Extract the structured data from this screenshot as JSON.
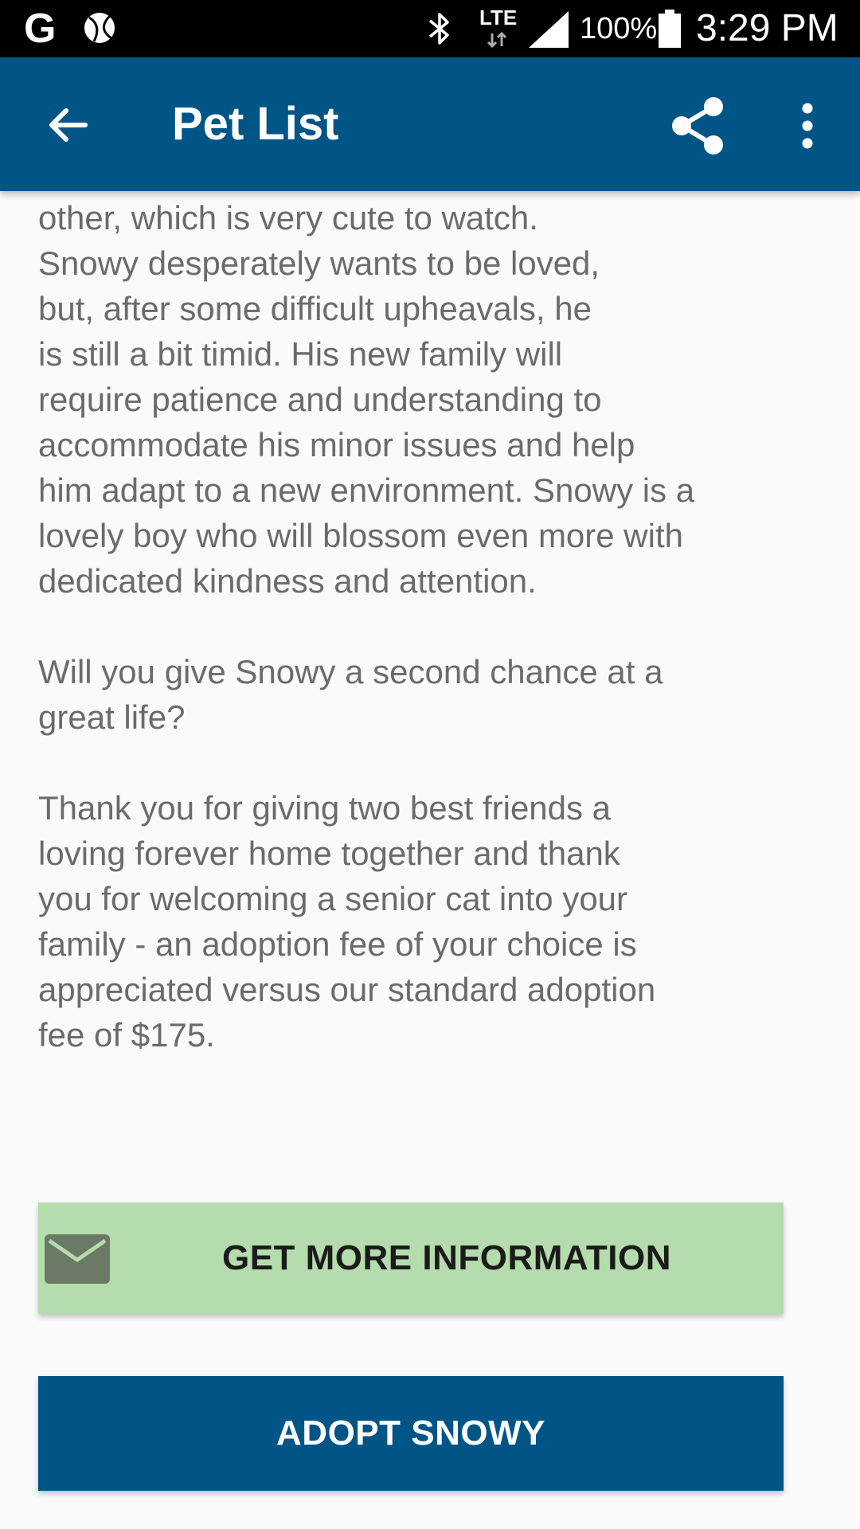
{
  "status_bar": {
    "lte_label": "LTE",
    "battery_percent": "100%",
    "time": "3:29 PM",
    "icons": [
      "google-icon",
      "ball-icon",
      "bluetooth-icon",
      "lte-icon",
      "signal-icon",
      "battery-icon"
    ]
  },
  "app_bar": {
    "title": "Pet List",
    "back_icon": "arrow-left-icon",
    "share_icon": "share-icon",
    "more_icon": "more-vert-icon",
    "color": "#005587"
  },
  "description": {
    "paragraphs": [
      "their own thing, but they do love to groom\nother, which is very cute to watch.\nSnowy desperately wants to be loved,\nbut, after some difficult upheavals, he\nis still a bit timid. His new family will\nrequire patience and understanding to\naccommodate his minor issues and help\nhim adapt to a new environment. Snowy is a\nlovely boy who will blossom even more with\ndedicated kindness and attention.",
      "Will you give Snowy a second chance at a\ngreat life?",
      "Thank you for giving two best friends a\nloving forever home together and thank\nyou for welcoming a senior cat into your\nfamily - an adoption fee of your choice is\nappreciated versus our standard adoption\nfee of $175."
    ]
  },
  "info_button": {
    "label": "GET MORE INFORMATION",
    "icon": "mail-icon",
    "color": "#b5dcac"
  },
  "adopt_button": {
    "label": "ADOPT SNOWY",
    "color": "#005587"
  }
}
